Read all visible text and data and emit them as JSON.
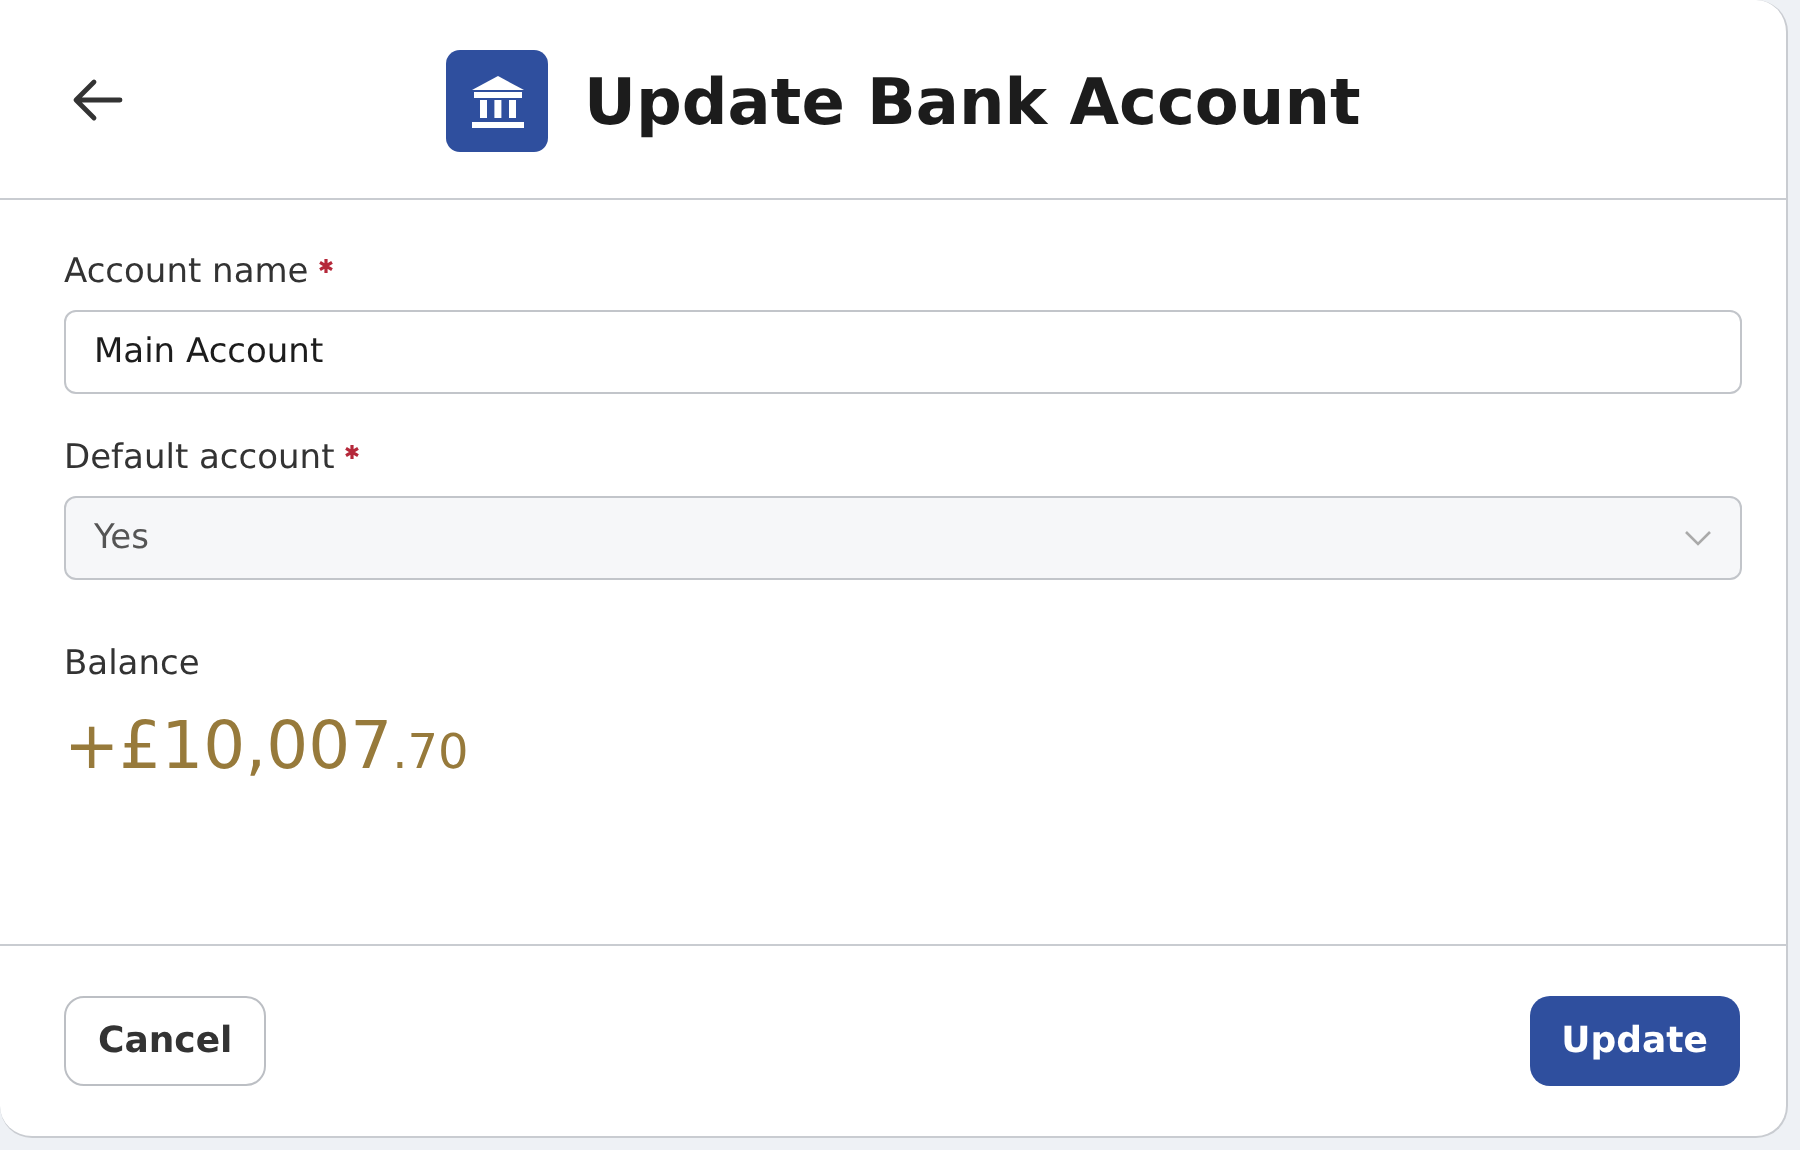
{
  "header": {
    "title": "Update Bank Account"
  },
  "fields": [
    {
      "kind": "text",
      "label": "Account name",
      "required": true,
      "value": "Main Account",
      "disabled": false
    },
    {
      "kind": "select",
      "label": "Default account",
      "required": true,
      "value": "Yes",
      "disabled": true
    }
  ],
  "balance": {
    "label": "Balance",
    "whole": "+£10,007",
    "fraction": ".70"
  },
  "buttons": [
    {
      "kind": "secondary",
      "label": "Cancel"
    },
    {
      "kind": "primary",
      "label": "Update"
    }
  ]
}
